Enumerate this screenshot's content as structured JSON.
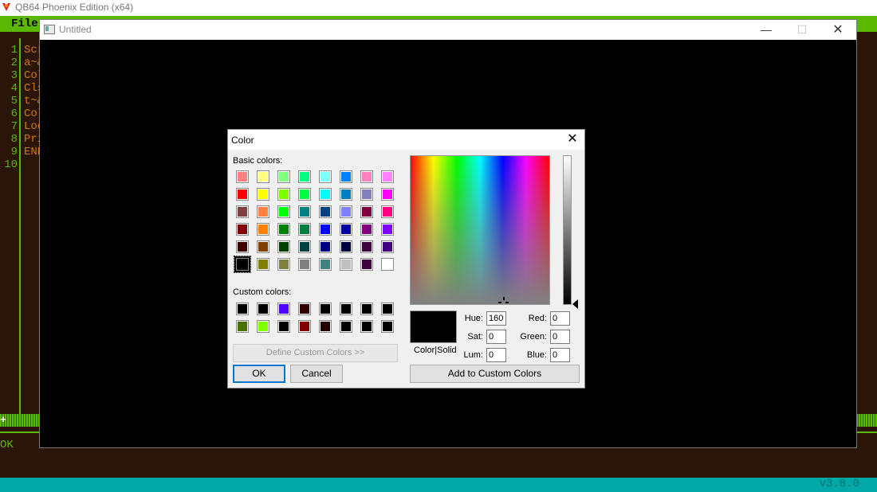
{
  "app": {
    "title": "QB64 Phoenix Edition (x64)",
    "menu_file": "File",
    "line_numbers": [
      "1",
      "2",
      "3",
      "4",
      "5",
      "6",
      "7",
      "8",
      "9",
      "10"
    ],
    "code_lines": [
      "Scr",
      "a~&",
      "Col",
      "Cls",
      "t~&",
      "Col",
      "Loo",
      "Pri",
      "END",
      ""
    ],
    "strip_plus": "+",
    "status_ok": "OK",
    "version": "v3.8.0"
  },
  "untitled": {
    "title": "Untitled",
    "minimize": "—",
    "maximize": "☐",
    "close": "✕"
  },
  "dialog": {
    "title": "Color",
    "close": "✕",
    "basic_colors_label": "Basic colors:",
    "custom_colors_label": "Custom colors:",
    "basic_colors": [
      "#ff8080",
      "#ffff80",
      "#80ff80",
      "#00ff80",
      "#80ffff",
      "#0080ff",
      "#ff80c0",
      "#ff80ff",
      "#ff0000",
      "#ffff00",
      "#80ff00",
      "#00ff40",
      "#00ffff",
      "#0080c0",
      "#8080c0",
      "#ff00ff",
      "#804040",
      "#ff8040",
      "#00ff00",
      "#008080",
      "#004080",
      "#8080ff",
      "#800040",
      "#ff0080",
      "#800000",
      "#ff8000",
      "#008000",
      "#008040",
      "#0000ff",
      "#0000a0",
      "#800080",
      "#8000ff",
      "#400000",
      "#804000",
      "#004000",
      "#004040",
      "#000080",
      "#000040",
      "#400040",
      "#400080",
      "#000000",
      "#808000",
      "#808040",
      "#808080",
      "#408080",
      "#c0c0c0",
      "#400040",
      "#ffffff"
    ],
    "custom_colors": [
      "#000000",
      "#000000",
      "#5000ff",
      "#300000",
      "#000000",
      "#000000",
      "#000000",
      "#000000",
      "#4a7000",
      "#80ff00",
      "#000000",
      "#800000",
      "#200000",
      "#000000",
      "#000000",
      "#000000"
    ],
    "define_button": "Define Custom Colors >>",
    "ok_button": "OK",
    "cancel_button": "Cancel",
    "color_solid_label": "Color|Solid",
    "hue_label": "Hue:",
    "sat_label": "Sat:",
    "lum_label": "Lum:",
    "red_label": "Red:",
    "green_label": "Green:",
    "blue_label": "Blue:",
    "hue_value": "160",
    "sat_value": "0",
    "lum_value": "0",
    "red_value": "0",
    "green_value": "0",
    "blue_value": "0",
    "add_button": "Add to Custom Colors",
    "selected_color": "#000000"
  }
}
